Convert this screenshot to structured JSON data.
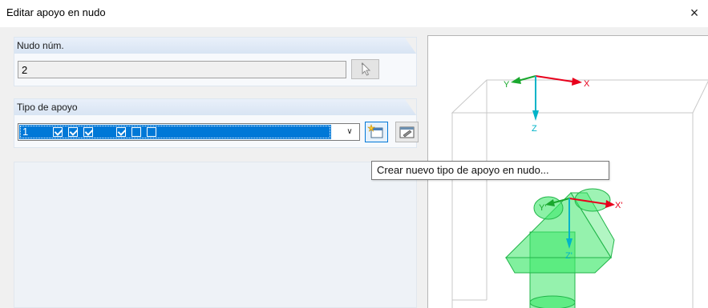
{
  "window": {
    "title": "Editar apoyo en nudo",
    "close_glyph": "×"
  },
  "node_group": {
    "label": "Nudo núm.",
    "value": "2",
    "pick_icon": "select-node-icon"
  },
  "support_group": {
    "label": "Tipo de apoyo",
    "selected_number": "1",
    "checkboxes": [
      true,
      true,
      true,
      true,
      false,
      false
    ],
    "buttons": {
      "new_icon": "new-support-type-icon",
      "edit_icon": "edit-support-type-icon"
    }
  },
  "tooltip": {
    "text": "Crear nuevo tipo de apoyo en nudo..."
  },
  "preview": {
    "global_axes": {
      "x": "X",
      "y": "Y",
      "z": "Z"
    },
    "local_axes": {
      "x": "X'",
      "y": "Y'",
      "z": "Z'"
    },
    "colors": {
      "x_axis": "#e8001c",
      "y_axis": "#1aa82e",
      "z_axis": "#00b4c8",
      "support": "#3ee86a"
    }
  }
}
